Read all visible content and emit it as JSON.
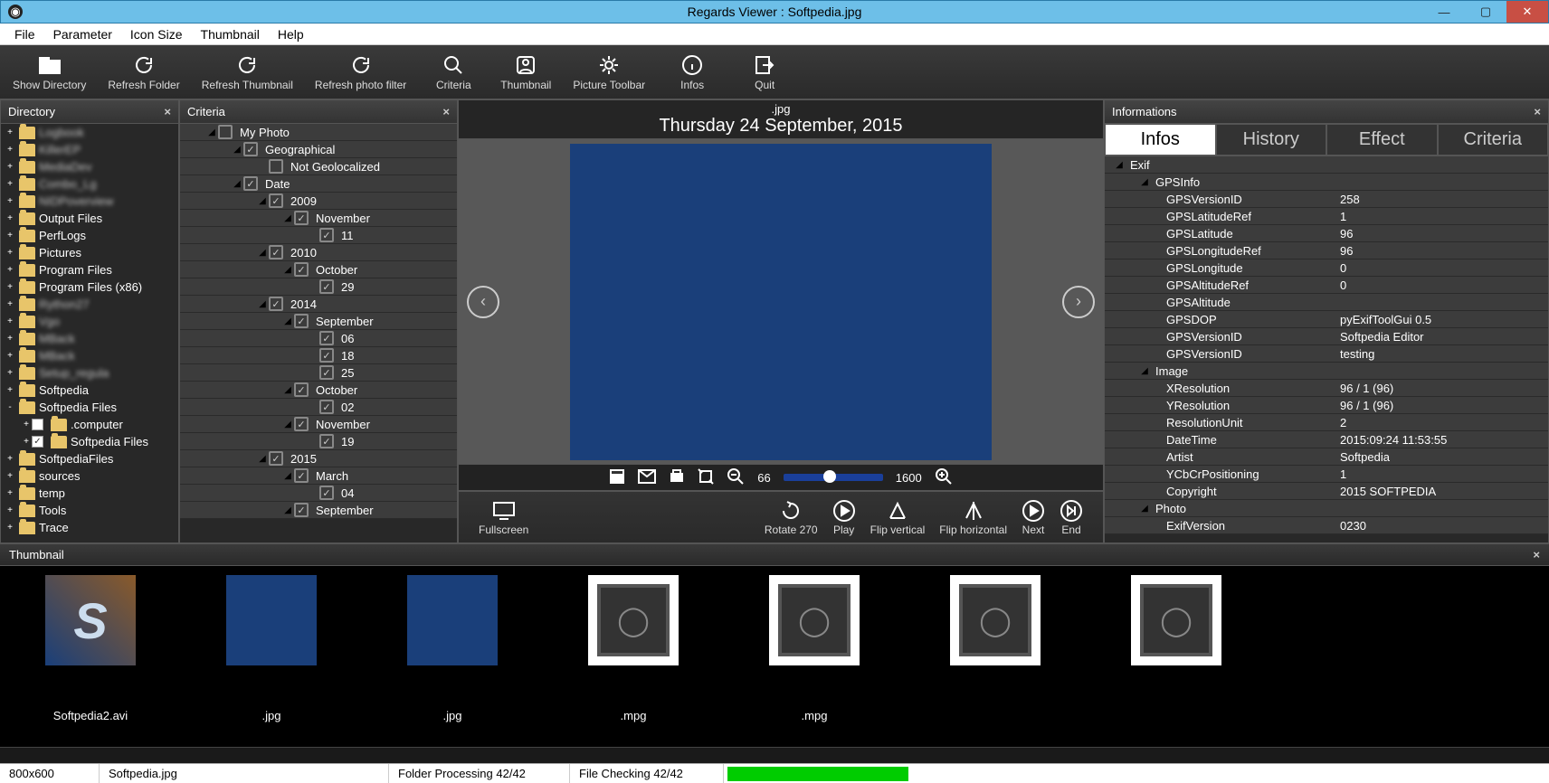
{
  "window": {
    "title": "Regards Viewer : Softpedia.jpg"
  },
  "menu": [
    "File",
    "Parameter",
    "Icon Size",
    "Thumbnail",
    "Help"
  ],
  "toolbar": [
    {
      "label": "Show Directory",
      "icon": "folder"
    },
    {
      "label": "Refresh Folder",
      "icon": "refresh"
    },
    {
      "label": "Refresh Thumbnail",
      "icon": "refresh"
    },
    {
      "label": "Refresh photo filter",
      "icon": "refresh"
    },
    {
      "label": "Criteria",
      "icon": "search"
    },
    {
      "label": "Thumbnail",
      "icon": "person"
    },
    {
      "label": "Picture Toolbar",
      "icon": "gear"
    },
    {
      "label": "Infos",
      "icon": "info"
    },
    {
      "label": "Quit",
      "icon": "exit"
    }
  ],
  "panels": {
    "directory": "Directory",
    "criteria": "Criteria",
    "informations": "Informations",
    "thumbnail": "Thumbnail"
  },
  "directory": [
    {
      "i": 0,
      "t": "Logbook",
      "b": true
    },
    {
      "i": 0,
      "t": "KillerEP",
      "b": true
    },
    {
      "i": 0,
      "t": "MediaDev",
      "b": true
    },
    {
      "i": 0,
      "t": "Combo_Lg",
      "b": true
    },
    {
      "i": 0,
      "t": "NIDPoverview",
      "b": true
    },
    {
      "i": 0,
      "t": "Output Files"
    },
    {
      "i": 0,
      "t": "PerfLogs"
    },
    {
      "i": 0,
      "t": "Pictures"
    },
    {
      "i": 0,
      "t": "Program Files"
    },
    {
      "i": 0,
      "t": "Program Files (x86)"
    },
    {
      "i": 0,
      "t": "Rython27",
      "b": true
    },
    {
      "i": 0,
      "t": "Vgo",
      "b": true
    },
    {
      "i": 0,
      "t": "MBack",
      "b": true
    },
    {
      "i": 0,
      "t": "MBack",
      "b": true
    },
    {
      "i": 0,
      "t": "Setup_regula",
      "b": true
    },
    {
      "i": 0,
      "t": "Softpedia"
    },
    {
      "i": 0,
      "t": "Softpedia Files",
      "exp": "-"
    },
    {
      "i": 1,
      "t": ".computer",
      "chk": " "
    },
    {
      "i": 1,
      "t": "Softpedia Files",
      "chk": "✓"
    },
    {
      "i": 0,
      "t": "SoftpediaFiles"
    },
    {
      "i": 0,
      "t": "sources"
    },
    {
      "i": 0,
      "t": "temp"
    },
    {
      "i": 0,
      "t": "Tools"
    },
    {
      "i": 0,
      "t": "Trace"
    }
  ],
  "criteria": [
    {
      "i": 1,
      "t": "My Photo",
      "tri": "◢",
      "cb": 0
    },
    {
      "i": 2,
      "t": "Geographical",
      "tri": "◢",
      "cb": 1
    },
    {
      "i": 3,
      "t": "Not Geolocalized",
      "tri": "",
      "cb": 0
    },
    {
      "i": 2,
      "t": "Date",
      "tri": "◢",
      "cb": 1
    },
    {
      "i": 3,
      "t": "2009",
      "tri": "◢",
      "cb": 1
    },
    {
      "i": 4,
      "t": "November",
      "tri": "◢",
      "cb": 1
    },
    {
      "i": 5,
      "t": "11",
      "tri": "",
      "cb": 1
    },
    {
      "i": 3,
      "t": "2010",
      "tri": "◢",
      "cb": 1
    },
    {
      "i": 4,
      "t": "October",
      "tri": "◢",
      "cb": 1
    },
    {
      "i": 5,
      "t": "29",
      "tri": "",
      "cb": 1
    },
    {
      "i": 3,
      "t": "2014",
      "tri": "◢",
      "cb": 1
    },
    {
      "i": 4,
      "t": "September",
      "tri": "◢",
      "cb": 1
    },
    {
      "i": 5,
      "t": "06",
      "tri": "",
      "cb": 1
    },
    {
      "i": 5,
      "t": "18",
      "tri": "",
      "cb": 1
    },
    {
      "i": 5,
      "t": "25",
      "tri": "",
      "cb": 1
    },
    {
      "i": 4,
      "t": "October",
      "tri": "◢",
      "cb": 1
    },
    {
      "i": 5,
      "t": "02",
      "tri": "",
      "cb": 1
    },
    {
      "i": 4,
      "t": "November",
      "tri": "◢",
      "cb": 1
    },
    {
      "i": 5,
      "t": "19",
      "tri": "",
      "cb": 1
    },
    {
      "i": 3,
      "t": "2015",
      "tri": "◢",
      "cb": 1
    },
    {
      "i": 4,
      "t": "March",
      "tri": "◢",
      "cb": 1
    },
    {
      "i": 5,
      "t": "04",
      "tri": "",
      "cb": 1
    },
    {
      "i": 4,
      "t": "September",
      "tri": "◢",
      "cb": 1
    }
  ],
  "viewer": {
    "filename": ".jpg",
    "date": "Thursday 24 September, 2015",
    "zoom_out_val": "66",
    "zoom_in_val": "1600",
    "actions": {
      "fullscreen": "Fullscreen",
      "rotate": "Rotate 270",
      "play": "Play",
      "flipv": "Flip vertical",
      "fliph": "Flip horizontal",
      "next": "Next",
      "end": "End"
    }
  },
  "info_tabs": [
    "Infos",
    "History",
    "Effect",
    "Criteria"
  ],
  "info_rows": [
    {
      "i": 0,
      "k": "Exif",
      "tri": "◢"
    },
    {
      "i": 1,
      "k": "GPSInfo",
      "tri": "◢"
    },
    {
      "i": 2,
      "k": "GPSVersionID",
      "v": "258"
    },
    {
      "i": 2,
      "k": "GPSLatitudeRef",
      "v": "1"
    },
    {
      "i": 2,
      "k": "GPSLatitude",
      "v": "96"
    },
    {
      "i": 2,
      "k": "GPSLongitudeRef",
      "v": "96"
    },
    {
      "i": 2,
      "k": "GPSLongitude",
      "v": "0"
    },
    {
      "i": 2,
      "k": "GPSAltitudeRef",
      "v": "0"
    },
    {
      "i": 2,
      "k": "GPSAltitude",
      "v": ""
    },
    {
      "i": 2,
      "k": "GPSDOP",
      "v": "pyExifToolGui 0.5"
    },
    {
      "i": 2,
      "k": "GPSVersionID",
      "v": "Softpedia Editor"
    },
    {
      "i": 2,
      "k": "GPSVersionID",
      "v": "testing"
    },
    {
      "i": 1,
      "k": "Image",
      "tri": "◢"
    },
    {
      "i": 2,
      "k": "XResolution",
      "v": "96 / 1 (96)"
    },
    {
      "i": 2,
      "k": "YResolution",
      "v": "96 / 1 (96)"
    },
    {
      "i": 2,
      "k": "ResolutionUnit",
      "v": "2"
    },
    {
      "i": 2,
      "k": "DateTime",
      "v": "2015:09:24 11:53:55"
    },
    {
      "i": 2,
      "k": "Artist",
      "v": "Softpedia"
    },
    {
      "i": 2,
      "k": "YCbCrPositioning",
      "v": "1"
    },
    {
      "i": 2,
      "k": "Copyright",
      "v": "2015 SOFTPEDIA"
    },
    {
      "i": 1,
      "k": "Photo",
      "tri": "◢"
    },
    {
      "i": 2,
      "k": "ExifVersion",
      "v": "0230"
    }
  ],
  "thumbnails": [
    {
      "type": "s",
      "cap": "Softpedia2.avi"
    },
    {
      "type": "blue",
      "cap": ".jpg"
    },
    {
      "type": "blue",
      "cap": ".jpg"
    },
    {
      "type": "cam",
      "cap": ".mpg"
    },
    {
      "type": "cam",
      "cap": ".mpg"
    },
    {
      "type": "cam",
      "cap": ""
    },
    {
      "type": "cam",
      "cap": ""
    }
  ],
  "status": {
    "dim": "800x600",
    "file": "Softpedia.jpg",
    "folder": "Folder Processing 42/42",
    "check": "File Checking 42/42"
  }
}
